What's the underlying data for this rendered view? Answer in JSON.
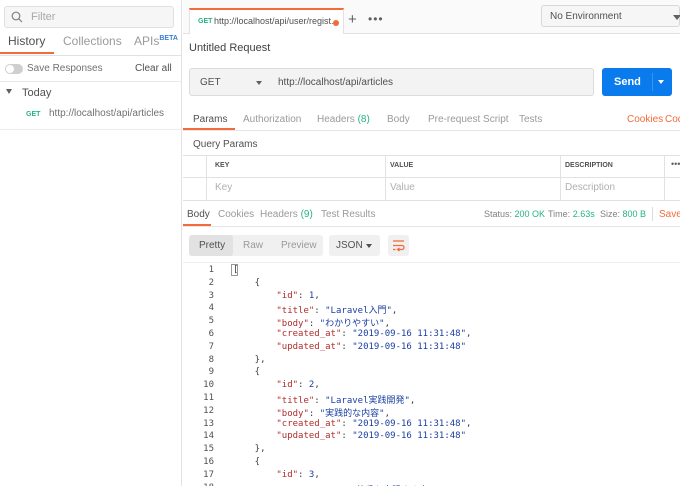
{
  "sidebar": {
    "filter_placeholder": "Filter",
    "tabs": {
      "history": "History",
      "collections": "Collections",
      "apis": "APIs",
      "apis_badge": "BETA"
    },
    "save_responses": "Save Responses",
    "clear_all": "Clear all",
    "group": "Today",
    "history_items": [
      {
        "method": "GET",
        "url": "http://localhost/api/articles"
      }
    ]
  },
  "tabbar": {
    "tab_method": "GET",
    "tab_url": "http://localhost/api/user/regist...",
    "plus": "+",
    "more": "•••",
    "environment": "No Environment"
  },
  "request": {
    "title": "Untitled Request",
    "method": "GET",
    "url": "http://localhost/api/articles",
    "send": "Send",
    "tabs": {
      "params": "Params",
      "authorization": "Authorization",
      "headers": "Headers",
      "headers_count": "(8)",
      "body": "Body",
      "prerequest": "Pre-request Script",
      "tests": "Tests",
      "cookies": "Cookies",
      "code": "Code"
    },
    "query_params_label": "Query Params",
    "table": {
      "headers": [
        "KEY",
        "VALUE",
        "DESCRIPTION"
      ],
      "placeholders": [
        "Key",
        "Value",
        "Description"
      ]
    }
  },
  "response": {
    "tabs": {
      "body": "Body",
      "cookies": "Cookies",
      "headers": "Headers",
      "headers_count": "(9)",
      "test_results": "Test Results"
    },
    "status_label": "Status:",
    "status_value": "200 OK",
    "time_label": "Time:",
    "time_value": "2.63s",
    "size_label": "Size:",
    "size_value": "800 B",
    "save": "Save",
    "formats": {
      "pretty": "Pretty",
      "raw": "Raw",
      "preview": "Preview"
    },
    "language": "JSON",
    "code_lines": [
      {
        "n": "1",
        "parts": [
          [
            "p",
            "["
          ]
        ]
      },
      {
        "n": "2",
        "parts": [
          [
            "p",
            "    {"
          ]
        ]
      },
      {
        "n": "3",
        "parts": [
          [
            "p",
            "        "
          ],
          [
            "k",
            "\"id\""
          ],
          [
            "p",
            ": "
          ],
          [
            "n",
            "1"
          ],
          [
            "p",
            ","
          ]
        ]
      },
      {
        "n": "4",
        "parts": [
          [
            "p",
            "        "
          ],
          [
            "k",
            "\"title\""
          ],
          [
            "p",
            ": "
          ],
          [
            "s",
            "\"Laravel入門\""
          ],
          [
            "p",
            ","
          ]
        ]
      },
      {
        "n": "5",
        "parts": [
          [
            "p",
            "        "
          ],
          [
            "k",
            "\"body\""
          ],
          [
            "p",
            ": "
          ],
          [
            "s",
            "\"わかりやすい\""
          ],
          [
            "p",
            ","
          ]
        ]
      },
      {
        "n": "6",
        "parts": [
          [
            "p",
            "        "
          ],
          [
            "k",
            "\"created_at\""
          ],
          [
            "p",
            ": "
          ],
          [
            "s",
            "\"2019-09-16 11:31:48\""
          ],
          [
            "p",
            ","
          ]
        ]
      },
      {
        "n": "7",
        "parts": [
          [
            "p",
            "        "
          ],
          [
            "k",
            "\"updated_at\""
          ],
          [
            "p",
            ": "
          ],
          [
            "s",
            "\"2019-09-16 11:31:48\""
          ]
        ]
      },
      {
        "n": "8",
        "parts": [
          [
            "p",
            "    },"
          ]
        ]
      },
      {
        "n": "9",
        "parts": [
          [
            "p",
            "    {"
          ]
        ]
      },
      {
        "n": "10",
        "parts": [
          [
            "p",
            "        "
          ],
          [
            "k",
            "\"id\""
          ],
          [
            "p",
            ": "
          ],
          [
            "n",
            "2"
          ],
          [
            "p",
            ","
          ]
        ]
      },
      {
        "n": "11",
        "parts": [
          [
            "p",
            "        "
          ],
          [
            "k",
            "\"title\""
          ],
          [
            "p",
            ": "
          ],
          [
            "s",
            "\"Laravel実践開発\""
          ],
          [
            "p",
            ","
          ]
        ]
      },
      {
        "n": "12",
        "parts": [
          [
            "p",
            "        "
          ],
          [
            "k",
            "\"body\""
          ],
          [
            "p",
            ": "
          ],
          [
            "s",
            "\"実践的な内容\""
          ],
          [
            "p",
            ","
          ]
        ]
      },
      {
        "n": "13",
        "parts": [
          [
            "p",
            "        "
          ],
          [
            "k",
            "\"created_at\""
          ],
          [
            "p",
            ": "
          ],
          [
            "s",
            "\"2019-09-16 11:31:48\""
          ],
          [
            "p",
            ","
          ]
        ]
      },
      {
        "n": "14",
        "parts": [
          [
            "p",
            "        "
          ],
          [
            "k",
            "\"updated_at\""
          ],
          [
            "p",
            ": "
          ],
          [
            "s",
            "\"2019-09-16 11:31:48\""
          ]
        ]
      },
      {
        "n": "15",
        "parts": [
          [
            "p",
            "    },"
          ]
        ]
      },
      {
        "n": "16",
        "parts": [
          [
            "p",
            "    {"
          ]
        ]
      },
      {
        "n": "17",
        "parts": [
          [
            "p",
            "        "
          ],
          [
            "k",
            "\"id\""
          ],
          [
            "p",
            ": "
          ],
          [
            "n",
            "3"
          ],
          [
            "p",
            ","
          ]
        ]
      },
      {
        "n": "18",
        "parts": [
          [
            "p",
            "        "
          ],
          [
            "k",
            "\"title\""
          ],
          [
            "p",
            ": "
          ],
          [
            "s",
            "\"SQLの苦手を克服する本\""
          ],
          [
            "p",
            ","
          ]
        ]
      }
    ]
  },
  "colors": {
    "accent": "#f26b3a",
    "send": "#097bed",
    "success": "#26b47f"
  }
}
